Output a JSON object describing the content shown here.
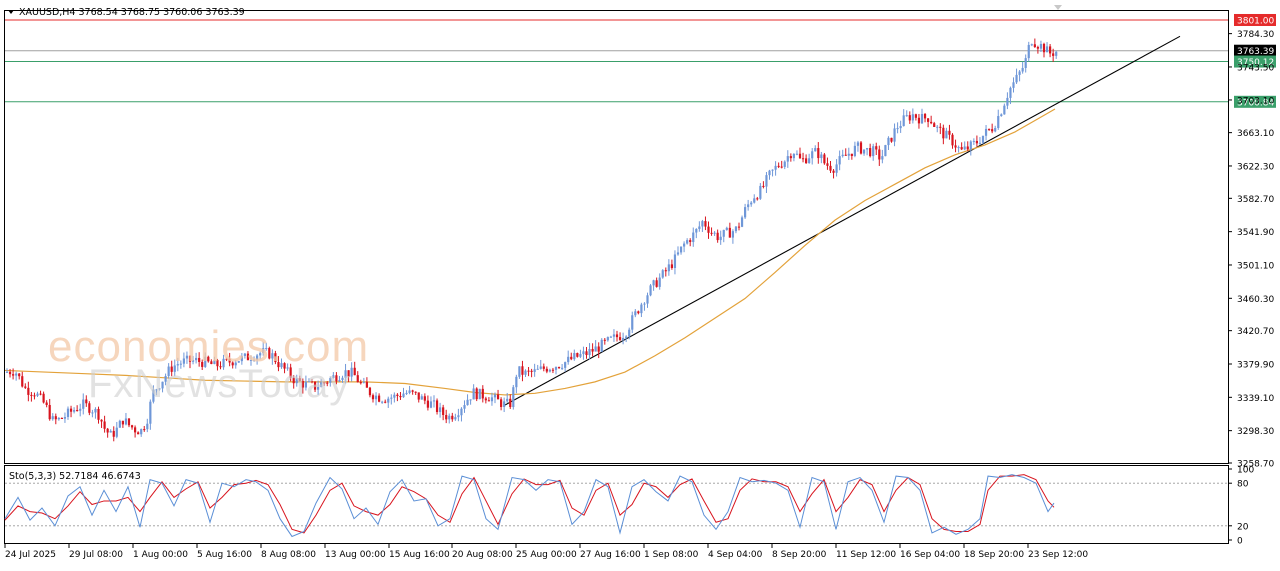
{
  "window": {
    "symbol_line": "XAUUSD,H4  3768.54 3768.75 3760.06 3763.39",
    "stoch_line": "Sto(5,3,3) 52.7184 46.6743"
  },
  "watermark": {
    "brand": "economies.com",
    "sub": "FxNewsToday"
  },
  "colors": {
    "bull": "#6f97d8",
    "bear": "#d8141e",
    "ma": "#e3a23a",
    "resistance": "#e52b2b",
    "support": "#3a9f6a",
    "price_line": "#a0a0a0",
    "stoch_main": "#5b8fd6",
    "stoch_signal": "#d8141e"
  },
  "chart_data": {
    "type": "candlestick",
    "symbol": "XAUUSD",
    "timeframe": "H4",
    "ohlc_last": {
      "open": 3768.54,
      "high": 3768.75,
      "low": 3760.06,
      "close": 3763.39
    },
    "ylim": [
      3258.7,
      3812
    ],
    "yticks": [
      "3784.30",
      "3743.50",
      "3703.10",
      "3663.10",
      "3622.30",
      "3582.70",
      "3541.90",
      "3501.10",
      "3460.30",
      "3420.70",
      "3379.90",
      "3339.10",
      "3298.30",
      "3258.70"
    ],
    "xticks": [
      "24 Jul 2025",
      "29 Jul 08:00",
      "1 Aug 00:00",
      "5 Aug 16:00",
      "8 Aug 08:00",
      "13 Aug 00:00",
      "15 Aug 16:00",
      "20 Aug 08:00",
      "25 Aug 00:00",
      "27 Aug 16:00",
      "1 Sep 08:00",
      "4 Sep 04:00",
      "8 Sep 20:00",
      "11 Sep 12:00",
      "16 Sep 04:00",
      "18 Sep 20:00",
      "23 Sep 12:00"
    ],
    "levels": [
      {
        "label": "3801.00",
        "value": 3801.0,
        "color": "#e52b2b"
      },
      {
        "label": "3763.39",
        "value": 3763.39,
        "color": "#000000"
      },
      {
        "label": "3750.12",
        "value": 3750.12,
        "color": "#3a9f6a"
      },
      {
        "label": "3700.84",
        "value": 3700.84,
        "color": "#3a9f6a"
      }
    ],
    "trendline": {
      "from": {
        "x": 504,
        "y": 3329
      },
      "to": {
        "x": 1180,
        "y": 3781
      }
    },
    "price_path": [
      [
        0,
        3370
      ],
      [
        10,
        3372
      ],
      [
        20,
        3350
      ],
      [
        30,
        3345
      ],
      [
        40,
        3330
      ],
      [
        48,
        3310
      ],
      [
        55,
        3312
      ],
      [
        62,
        3318
      ],
      [
        70,
        3325
      ],
      [
        78,
        3330
      ],
      [
        86,
        3326
      ],
      [
        94,
        3318
      ],
      [
        100,
        3300
      ],
      [
        106,
        3292
      ],
      [
        112,
        3300
      ],
      [
        118,
        3312
      ],
      [
        124,
        3305
      ],
      [
        130,
        3300
      ],
      [
        136,
        3298
      ],
      [
        142,
        3312
      ],
      [
        148,
        3345
      ],
      [
        154,
        3355
      ],
      [
        160,
        3365
      ],
      [
        166,
        3375
      ],
      [
        172,
        3380
      ],
      [
        180,
        3383
      ],
      [
        190,
        3384
      ],
      [
        200,
        3382
      ],
      [
        210,
        3378
      ],
      [
        220,
        3381
      ],
      [
        230,
        3385
      ],
      [
        240,
        3387
      ],
      [
        250,
        3392
      ],
      [
        258,
        3394
      ],
      [
        266,
        3392
      ],
      [
        274,
        3380
      ],
      [
        282,
        3370
      ],
      [
        290,
        3360
      ],
      [
        300,
        3355
      ],
      [
        310,
        3352
      ],
      [
        320,
        3358
      ],
      [
        330,
        3365
      ],
      [
        340,
        3370
      ],
      [
        348,
        3368
      ],
      [
        356,
        3355
      ],
      [
        364,
        3346
      ],
      [
        372,
        3340
      ],
      [
        380,
        3338
      ],
      [
        390,
        3340
      ],
      [
        400,
        3345
      ],
      [
        410,
        3342
      ],
      [
        420,
        3335
      ],
      [
        428,
        3330
      ],
      [
        436,
        3320
      ],
      [
        444,
        3315
      ],
      [
        452,
        3322
      ],
      [
        460,
        3334
      ],
      [
        468,
        3345
      ],
      [
        476,
        3342
      ],
      [
        484,
        3340
      ],
      [
        492,
        3335
      ],
      [
        500,
        3330
      ],
      [
        506,
        3332
      ],
      [
        512,
        3372
      ],
      [
        520,
        3368
      ],
      [
        530,
        3370
      ],
      [
        540,
        3375
      ],
      [
        550,
        3378
      ],
      [
        560,
        3382
      ],
      [
        570,
        3388
      ],
      [
        580,
        3392
      ],
      [
        590,
        3398
      ],
      [
        600,
        3405
      ],
      [
        610,
        3412
      ],
      [
        620,
        3418
      ],
      [
        630,
        3440
      ],
      [
        640,
        3462
      ],
      [
        650,
        3478
      ],
      [
        660,
        3492
      ],
      [
        670,
        3508
      ],
      [
        680,
        3528
      ],
      [
        690,
        3540
      ],
      [
        698,
        3555
      ],
      [
        706,
        3542
      ],
      [
        714,
        3535
      ],
      [
        722,
        3540
      ],
      [
        732,
        3545
      ],
      [
        740,
        3568
      ],
      [
        748,
        3585
      ],
      [
        756,
        3592
      ],
      [
        764,
        3610
      ],
      [
        772,
        3622
      ],
      [
        780,
        3630
      ],
      [
        788,
        3642
      ],
      [
        796,
        3628
      ],
      [
        804,
        3635
      ],
      [
        812,
        3640
      ],
      [
        820,
        3625
      ],
      [
        828,
        3620
      ],
      [
        836,
        3630
      ],
      [
        844,
        3638
      ],
      [
        852,
        3645
      ],
      [
        860,
        3642
      ],
      [
        868,
        3640
      ],
      [
        876,
        3632
      ],
      [
        884,
        3652
      ],
      [
        892,
        3670
      ],
      [
        900,
        3680
      ],
      [
        908,
        3685
      ],
      [
        916,
        3680
      ],
      [
        924,
        3682
      ],
      [
        932,
        3668
      ],
      [
        940,
        3660
      ],
      [
        948,
        3652
      ],
      [
        956,
        3640
      ],
      [
        964,
        3645
      ],
      [
        972,
        3652
      ],
      [
        980,
        3662
      ],
      [
        988,
        3670
      ],
      [
        996,
        3690
      ],
      [
        1004,
        3715
      ],
      [
        1012,
        3730
      ],
      [
        1020,
        3748
      ],
      [
        1026,
        3778
      ],
      [
        1032,
        3772
      ],
      [
        1038,
        3768
      ],
      [
        1044,
        3760
      ],
      [
        1050,
        3762
      ],
      [
        1054,
        3763
      ]
    ],
    "ma_path": [
      [
        0,
        3372
      ],
      [
        40,
        3370
      ],
      [
        80,
        3368
      ],
      [
        120,
        3366
      ],
      [
        160,
        3363
      ],
      [
        200,
        3360
      ],
      [
        240,
        3359
      ],
      [
        280,
        3358
      ],
      [
        320,
        3358
      ],
      [
        360,
        3358
      ],
      [
        400,
        3356
      ],
      [
        440,
        3350
      ],
      [
        470,
        3345
      ],
      [
        500,
        3342
      ],
      [
        530,
        3344
      ],
      [
        560,
        3350
      ],
      [
        590,
        3358
      ],
      [
        620,
        3370
      ],
      [
        650,
        3390
      ],
      [
        680,
        3412
      ],
      [
        710,
        3436
      ],
      [
        740,
        3460
      ],
      [
        770,
        3492
      ],
      [
        800,
        3525
      ],
      [
        830,
        3556
      ],
      [
        860,
        3580
      ],
      [
        890,
        3600
      ],
      [
        920,
        3620
      ],
      [
        950,
        3636
      ],
      [
        980,
        3648
      ],
      [
        1010,
        3664
      ],
      [
        1030,
        3678
      ],
      [
        1050,
        3692
      ]
    ],
    "stochastic": {
      "params": "5,3,3",
      "main": 52.7184,
      "signal": 46.6743,
      "ylim": [
        0,
        100
      ],
      "levels": [
        20,
        80
      ],
      "yticks": [
        "100",
        "80",
        "20",
        "0"
      ],
      "k_path": [
        [
          5,
          30
        ],
        [
          18,
          60
        ],
        [
          30,
          28
        ],
        [
          42,
          45
        ],
        [
          55,
          20
        ],
        [
          68,
          62
        ],
        [
          80,
          75
        ],
        [
          92,
          35
        ],
        [
          104,
          70
        ],
        [
          116,
          40
        ],
        [
          128,
          75
        ],
        [
          140,
          18
        ],
        [
          150,
          85
        ],
        [
          162,
          80
        ],
        [
          174,
          48
        ],
        [
          186,
          85
        ],
        [
          198,
          80
        ],
        [
          210,
          25
        ],
        [
          222,
          80
        ],
        [
          234,
          75
        ],
        [
          246,
          85
        ],
        [
          256,
          82
        ],
        [
          268,
          70
        ],
        [
          280,
          30
        ],
        [
          292,
          5
        ],
        [
          304,
          12
        ],
        [
          316,
          52
        ],
        [
          330,
          88
        ],
        [
          342,
          72
        ],
        [
          354,
          30
        ],
        [
          366,
          45
        ],
        [
          378,
          22
        ],
        [
          390,
          68
        ],
        [
          402,
          85
        ],
        [
          414,
          55
        ],
        [
          426,
          58
        ],
        [
          438,
          20
        ],
        [
          450,
          30
        ],
        [
          462,
          90
        ],
        [
          474,
          85
        ],
        [
          486,
          30
        ],
        [
          498,
          15
        ],
        [
          512,
          88
        ],
        [
          524,
          85
        ],
        [
          536,
          70
        ],
        [
          548,
          85
        ],
        [
          560,
          82
        ],
        [
          572,
          22
        ],
        [
          584,
          40
        ],
        [
          596,
          85
        ],
        [
          608,
          75
        ],
        [
          620,
          10
        ],
        [
          632,
          75
        ],
        [
          644,
          85
        ],
        [
          656,
          68
        ],
        [
          668,
          55
        ],
        [
          680,
          90
        ],
        [
          692,
          82
        ],
        [
          704,
          35
        ],
        [
          716,
          15
        ],
        [
          728,
          40
        ],
        [
          740,
          88
        ],
        [
          752,
          82
        ],
        [
          764,
          84
        ],
        [
          776,
          80
        ],
        [
          788,
          70
        ],
        [
          800,
          18
        ],
        [
          812,
          88
        ],
        [
          824,
          82
        ],
        [
          836,
          15
        ],
        [
          848,
          82
        ],
        [
          860,
          88
        ],
        [
          872,
          70
        ],
        [
          884,
          25
        ],
        [
          896,
          90
        ],
        [
          908,
          88
        ],
        [
          920,
          70
        ],
        [
          932,
          10
        ],
        [
          944,
          18
        ],
        [
          956,
          8
        ],
        [
          968,
          15
        ],
        [
          980,
          30
        ],
        [
          988,
          90
        ],
        [
          1000,
          88
        ],
        [
          1012,
          92
        ],
        [
          1024,
          88
        ],
        [
          1036,
          80
        ],
        [
          1048,
          40
        ],
        [
          1054,
          52
        ]
      ],
      "d_path": [
        [
          5,
          28
        ],
        [
          18,
          48
        ],
        [
          30,
          40
        ],
        [
          42,
          38
        ],
        [
          55,
          30
        ],
        [
          68,
          48
        ],
        [
          80,
          68
        ],
        [
          92,
          50
        ],
        [
          104,
          55
        ],
        [
          116,
          55
        ],
        [
          128,
          60
        ],
        [
          140,
          40
        ],
        [
          150,
          60
        ],
        [
          162,
          82
        ],
        [
          174,
          60
        ],
        [
          186,
          72
        ],
        [
          198,
          82
        ],
        [
          210,
          45
        ],
        [
          222,
          60
        ],
        [
          234,
          78
        ],
        [
          246,
          80
        ],
        [
          256,
          84
        ],
        [
          268,
          78
        ],
        [
          280,
          50
        ],
        [
          292,
          15
        ],
        [
          304,
          10
        ],
        [
          316,
          35
        ],
        [
          330,
          70
        ],
        [
          342,
          80
        ],
        [
          354,
          48
        ],
        [
          366,
          40
        ],
        [
          378,
          35
        ],
        [
          390,
          50
        ],
        [
          402,
          75
        ],
        [
          414,
          68
        ],
        [
          426,
          58
        ],
        [
          438,
          35
        ],
        [
          450,
          25
        ],
        [
          462,
          65
        ],
        [
          474,
          88
        ],
        [
          486,
          55
        ],
        [
          498,
          22
        ],
        [
          512,
          65
        ],
        [
          524,
          86
        ],
        [
          536,
          78
        ],
        [
          548,
          78
        ],
        [
          560,
          84
        ],
        [
          572,
          45
        ],
        [
          584,
          35
        ],
        [
          596,
          70
        ],
        [
          608,
          80
        ],
        [
          620,
          35
        ],
        [
          632,
          50
        ],
        [
          644,
          80
        ],
        [
          656,
          75
        ],
        [
          668,
          60
        ],
        [
          680,
          78
        ],
        [
          692,
          86
        ],
        [
          704,
          55
        ],
        [
          716,
          25
        ],
        [
          728,
          30
        ],
        [
          740,
          70
        ],
        [
          752,
          86
        ],
        [
          764,
          82
        ],
        [
          776,
          82
        ],
        [
          788,
          75
        ],
        [
          800,
          40
        ],
        [
          812,
          65
        ],
        [
          824,
          85
        ],
        [
          836,
          40
        ],
        [
          848,
          60
        ],
        [
          860,
          85
        ],
        [
          872,
          78
        ],
        [
          884,
          40
        ],
        [
          896,
          70
        ],
        [
          908,
          88
        ],
        [
          920,
          78
        ],
        [
          932,
          30
        ],
        [
          944,
          15
        ],
        [
          956,
          12
        ],
        [
          968,
          12
        ],
        [
          980,
          22
        ],
        [
          988,
          70
        ],
        [
          1000,
          90
        ],
        [
          1012,
          90
        ],
        [
          1024,
          92
        ],
        [
          1036,
          85
        ],
        [
          1048,
          55
        ],
        [
          1054,
          46
        ]
      ]
    }
  }
}
